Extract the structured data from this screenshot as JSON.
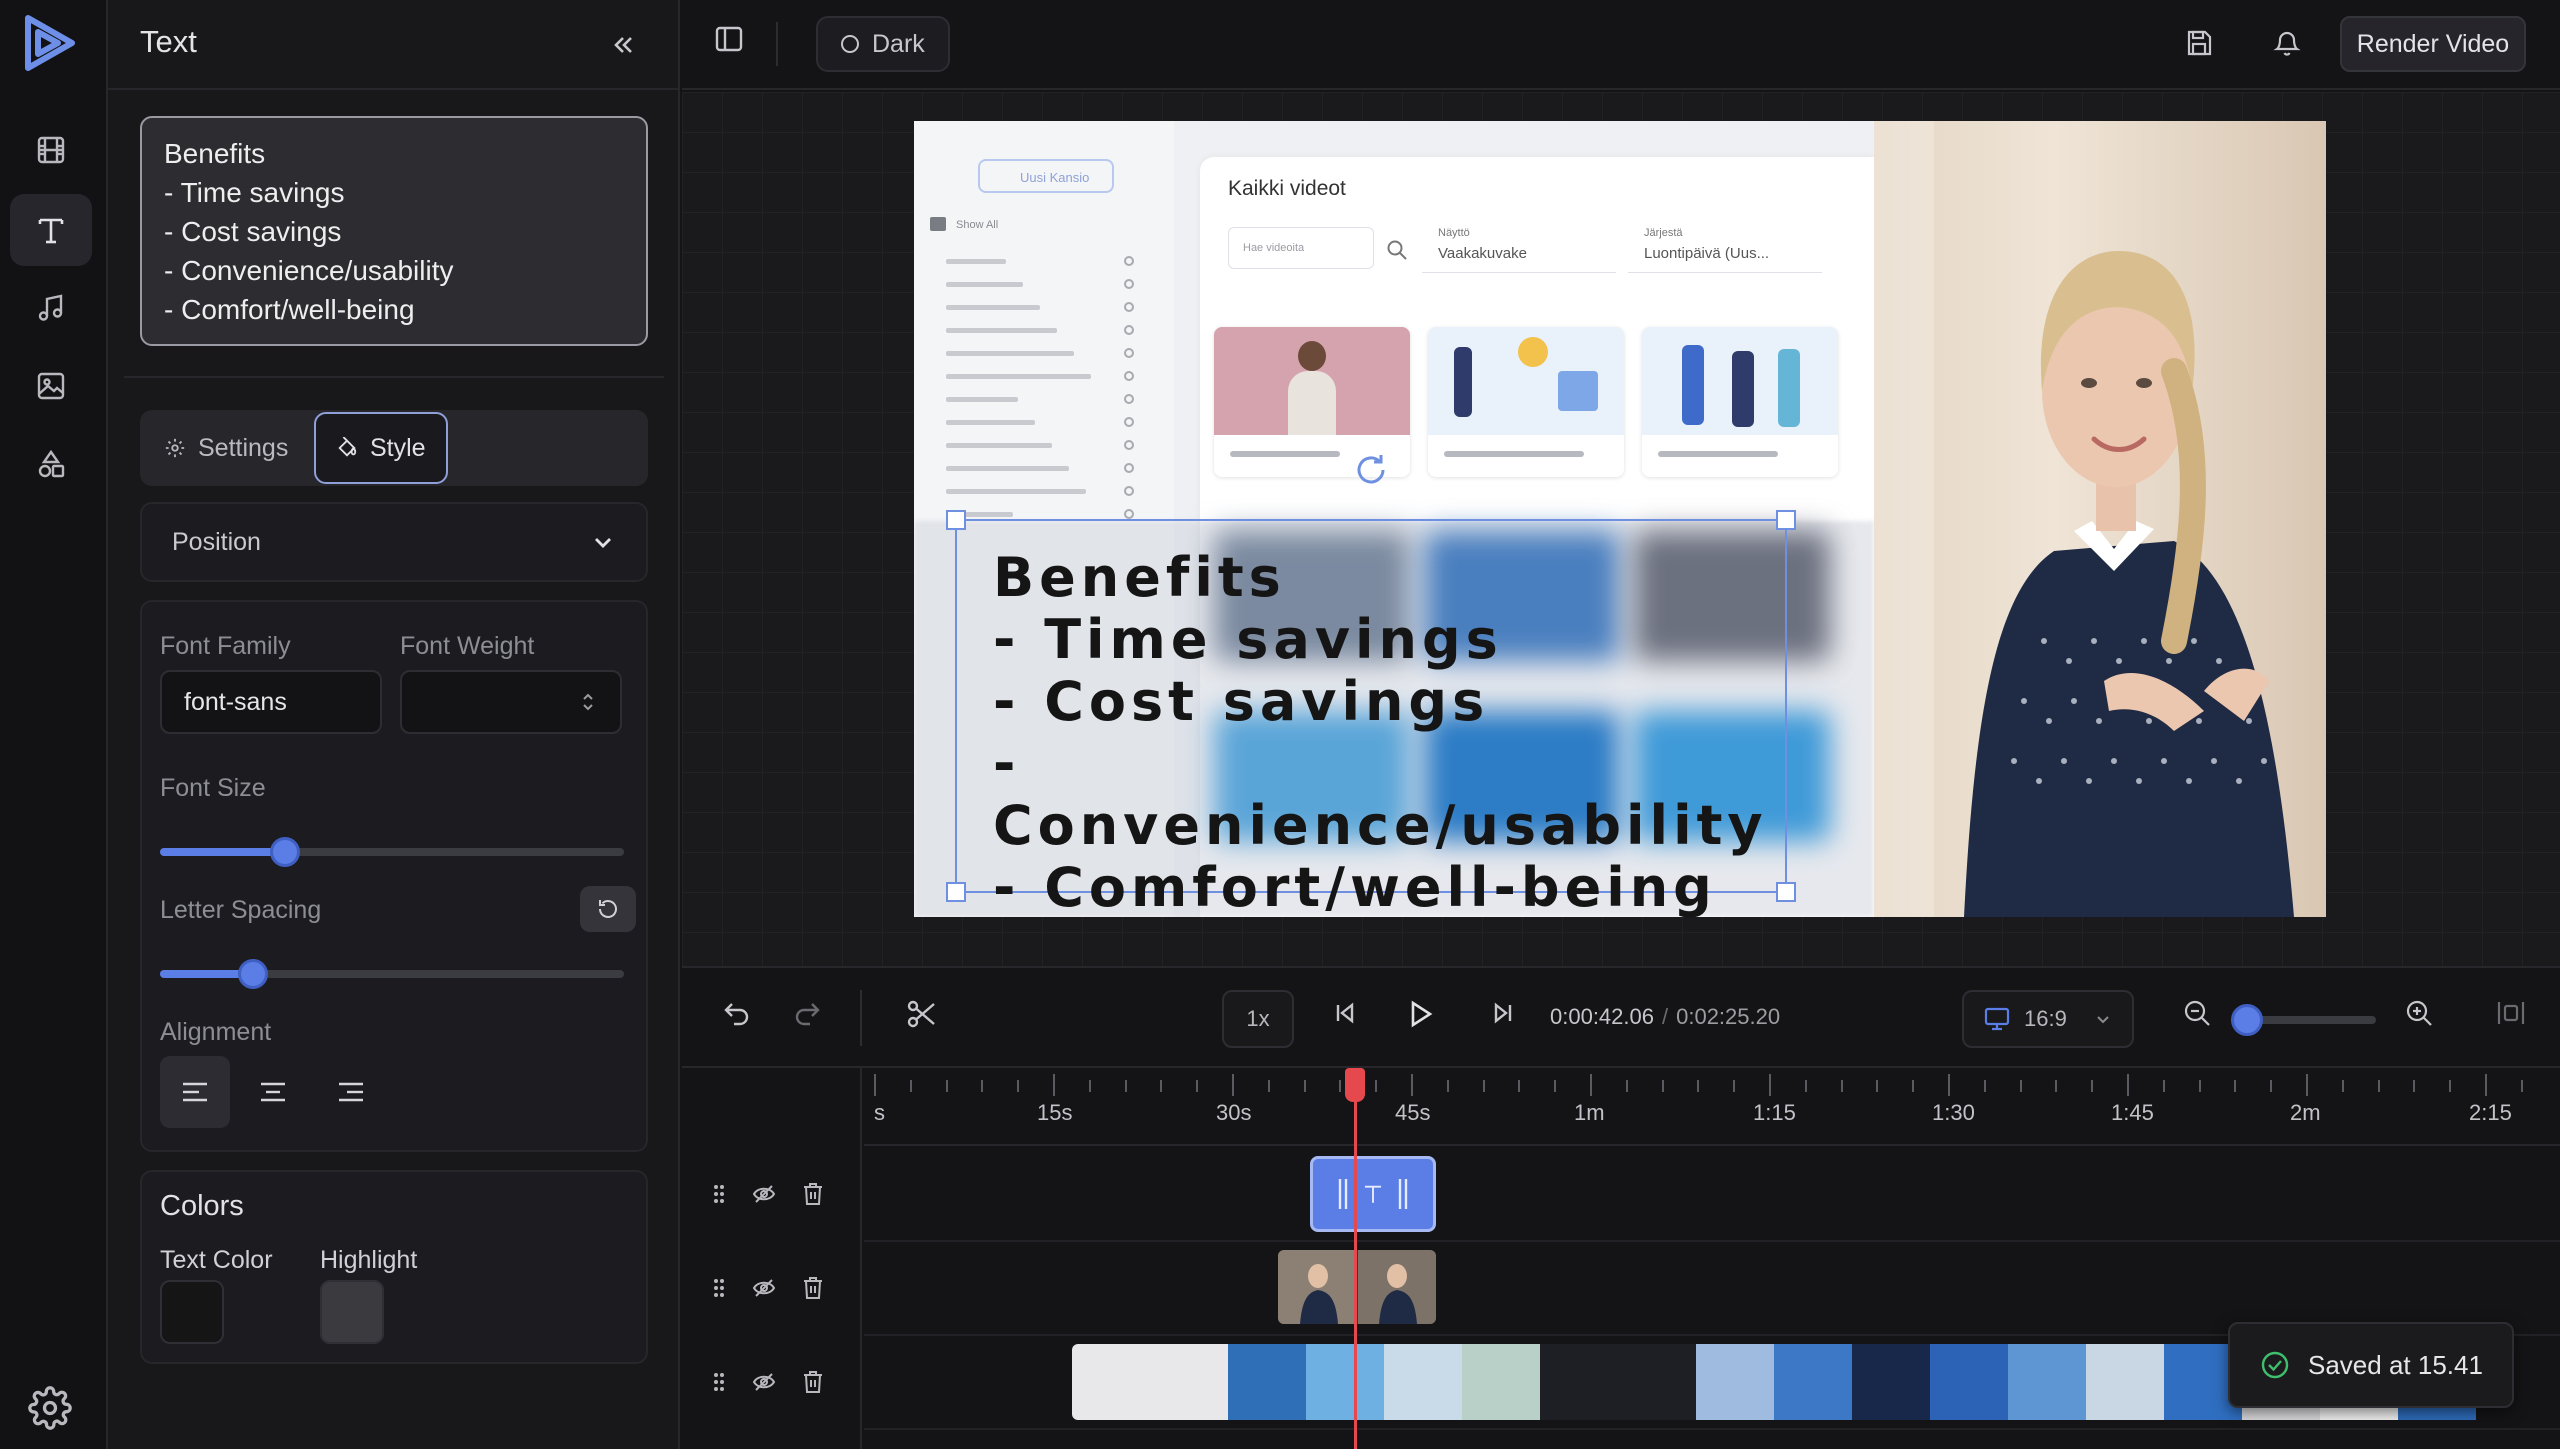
{
  "app": {
    "logo_icon": "play-triangle-logo-icon",
    "accent": "#5a7de6"
  },
  "rail": {
    "items": [
      {
        "icon": "film-icon",
        "active": false
      },
      {
        "icon": "text-icon",
        "active": true
      },
      {
        "icon": "music-note-icon",
        "active": false
      },
      {
        "icon": "image-icon",
        "active": false
      },
      {
        "icon": "shapes-icon",
        "active": false
      }
    ],
    "settings_icon": "gear-icon"
  },
  "panel": {
    "title": "Text",
    "text_content": "Benefits\n- Time savings\n- Cost savings\n- Convenience/usability\n- Comfort/well-being",
    "tabs": {
      "settings": "Settings",
      "style": "Style",
      "active": "Style"
    },
    "position_label": "Position",
    "font_family_label": "Font Family",
    "font_family_value": "font-sans",
    "font_weight_label": "Font Weight",
    "font_weight_value": "",
    "font_size_label": "Font Size",
    "font_size_fraction": 0.27,
    "letter_spacing_label": "Letter Spacing",
    "letter_spacing_fraction": 0.2,
    "alignment_label": "Alignment",
    "alignment_active": "left",
    "colors_title": "Colors",
    "text_color_label": "Text Color",
    "text_color": "#151515",
    "highlight_label": "Highlight",
    "highlight_color": "#3a3a3f"
  },
  "topbar": {
    "theme_label": "Dark",
    "render_label": "Render Video"
  },
  "canvas": {
    "overlay_text": "Benefits\n- Time savings\n- Cost savings\n- Convenience/usability\n- Comfort/well-being",
    "screen": {
      "folder_button": "Uusi Kansio",
      "show_all": "Show All",
      "title": "Kaikki videot",
      "search_placeholder": "Hae videoita",
      "filter1_label": "Näyttö",
      "filter1_value": "Vaakakuvake",
      "filter2_label": "Järjestä",
      "filter2_value": "Luontipäivä (Uus..."
    }
  },
  "transport": {
    "speed": "1x",
    "current_time": "0:00:42.06",
    "total_time": "0:02:25.20",
    "aspect_ratio": "16:9",
    "zoom_fraction": 0.1
  },
  "timeline": {
    "ticks": [
      "s",
      "15s",
      "30s",
      "45s",
      "1m",
      "1:15",
      "1:30",
      "1:45",
      "2m",
      "2:15"
    ]
  },
  "toast": {
    "message": "Saved at 15.41"
  }
}
